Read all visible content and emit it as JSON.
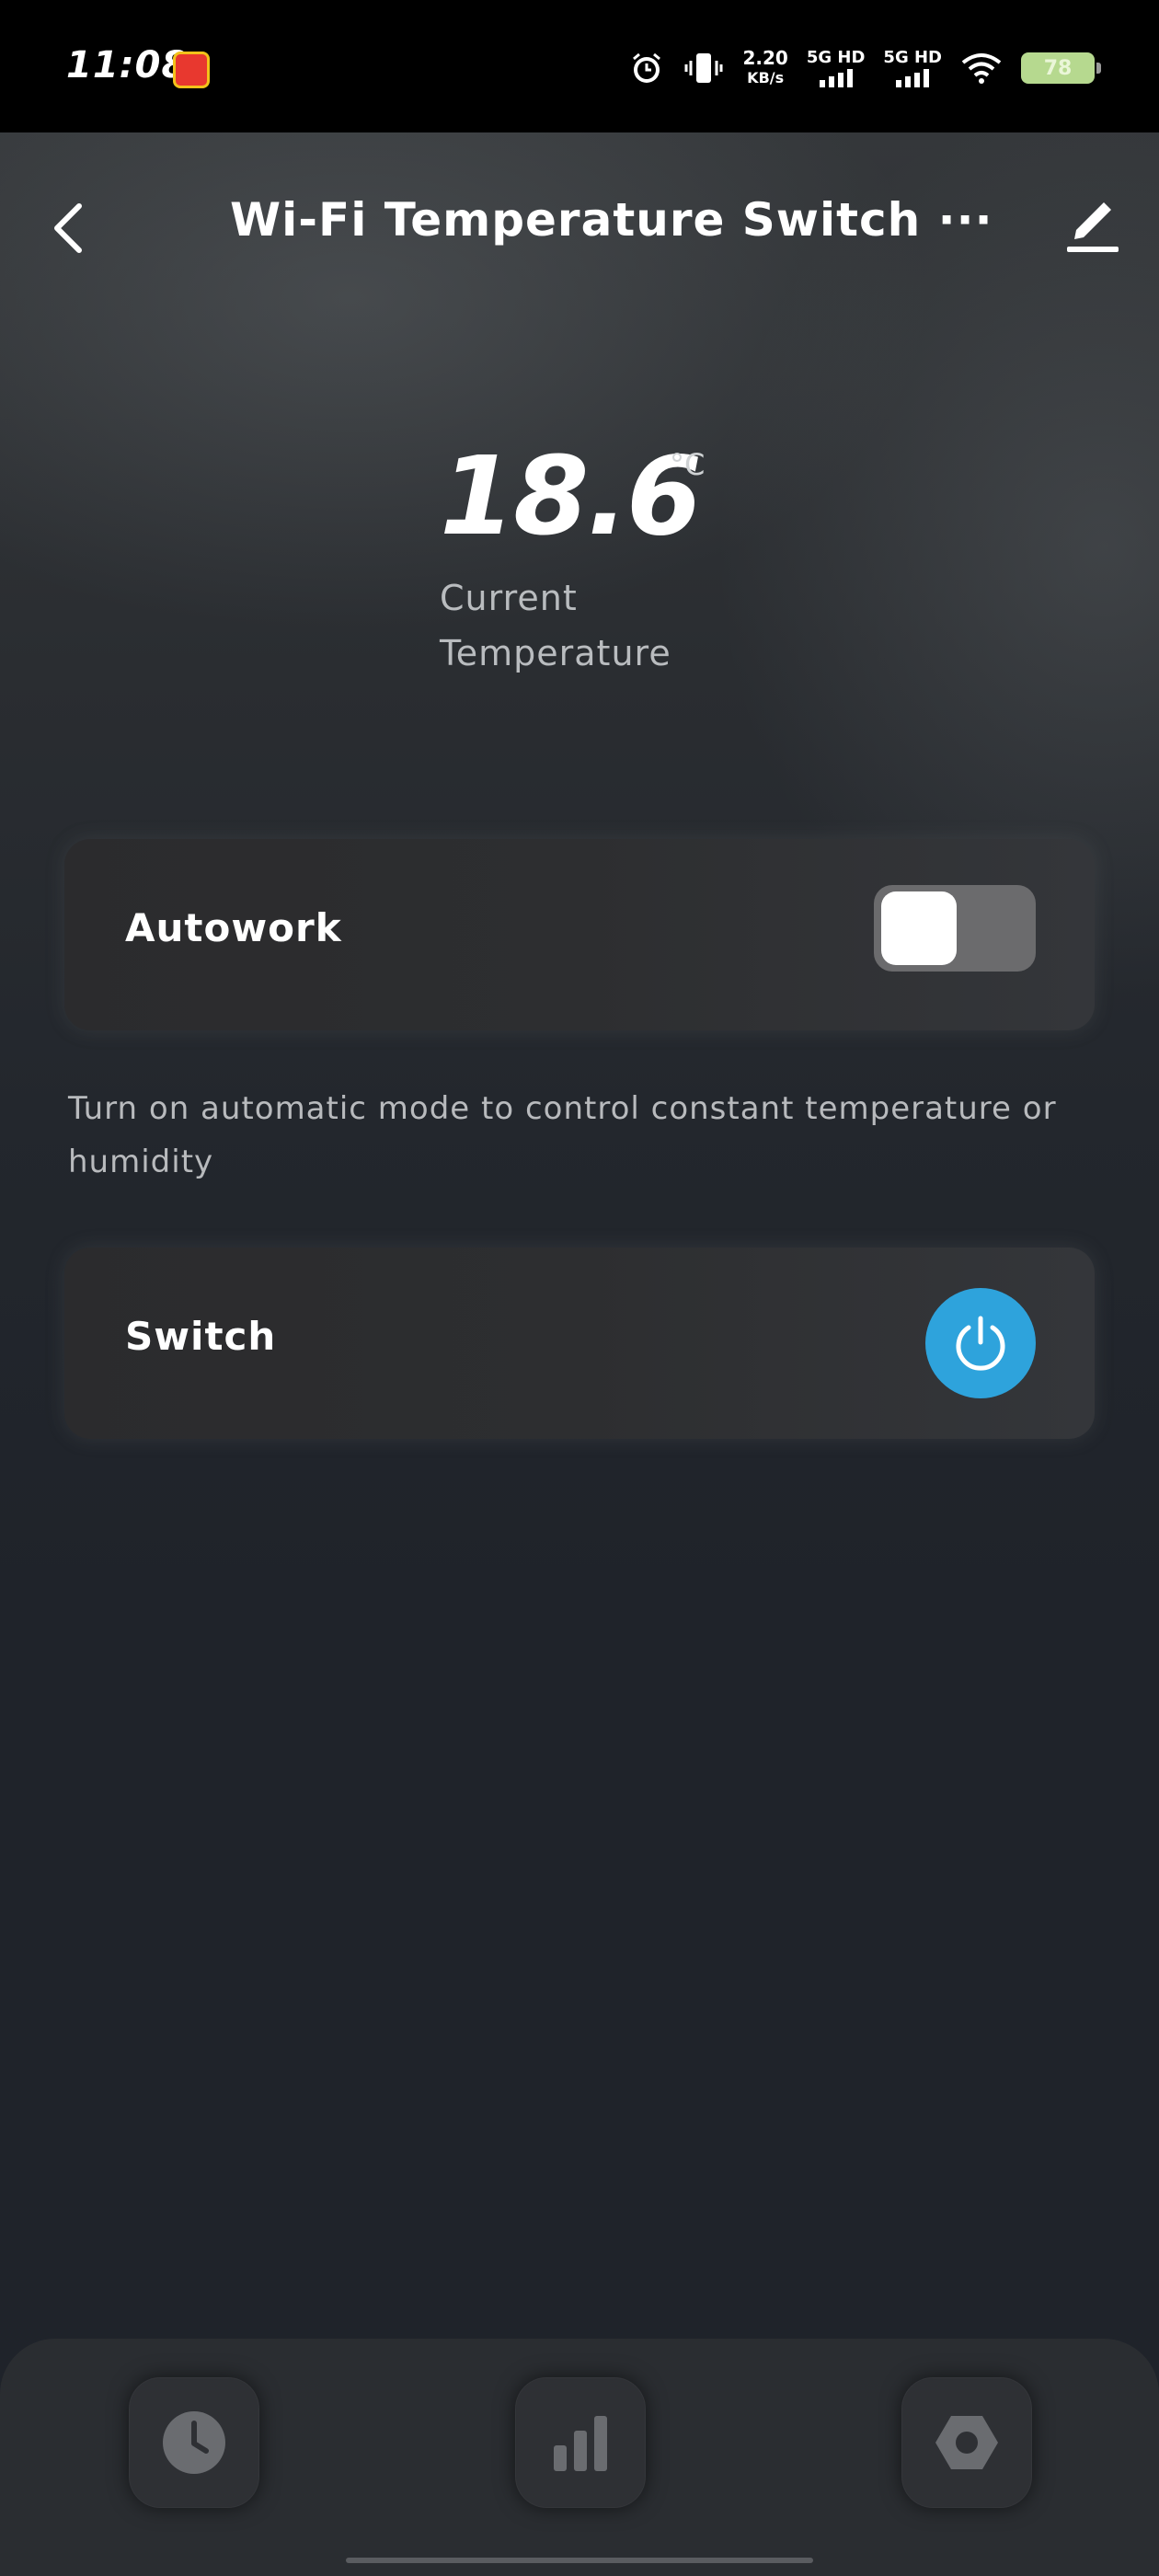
{
  "status_bar": {
    "time": "11:08",
    "net_speed_value": "2.20",
    "net_speed_unit": "KB/s",
    "sim1_label": "5G HD",
    "sim2_label": "5G HD",
    "battery_level": "78"
  },
  "header": {
    "title": "Wi-Fi Temperature Switch ···",
    "back_icon": "chevron-left-icon",
    "edit_icon": "pencil-icon"
  },
  "temperature": {
    "value": "18.6",
    "unit": "°C",
    "label": "Current Temperature"
  },
  "autowork": {
    "label": "Autowork",
    "enabled": false,
    "helper_text": "Turn on automatic mode to control constant temperature or humidity"
  },
  "switch": {
    "label": "Switch",
    "icon": "power-icon",
    "color": "#2ea3dc"
  },
  "bottom_nav": {
    "items": [
      {
        "icon": "clock-icon"
      },
      {
        "icon": "bar-chart-icon"
      },
      {
        "icon": "settings-hex-icon"
      }
    ]
  }
}
